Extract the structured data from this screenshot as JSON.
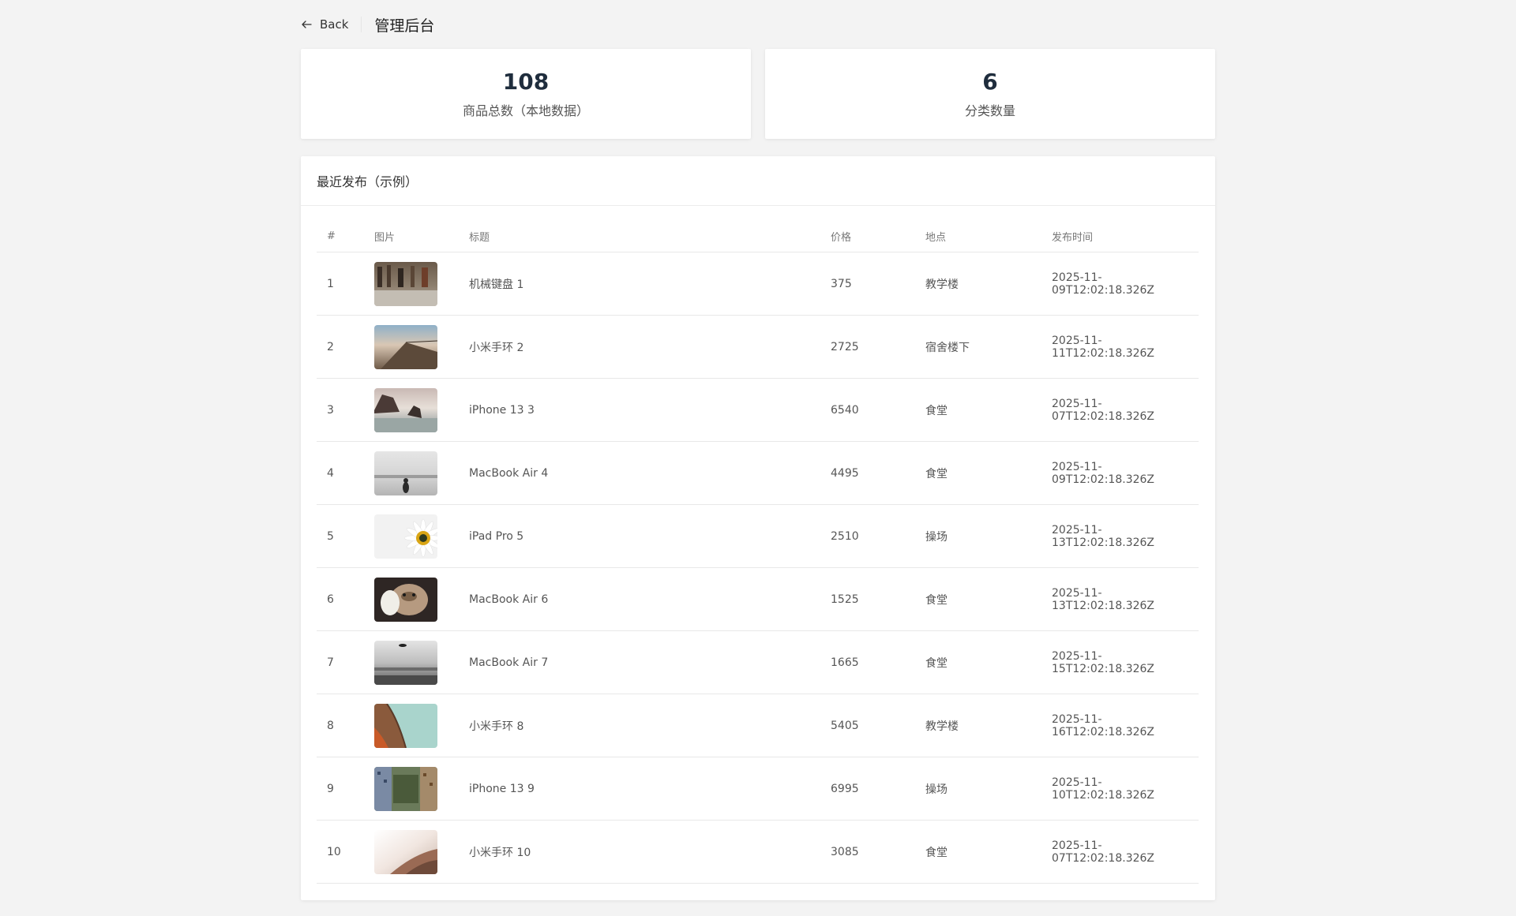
{
  "header": {
    "back_label": "Back",
    "title": "管理后台"
  },
  "stats": [
    {
      "value": "108",
      "label": "商品总数（本地数据）"
    },
    {
      "value": "6",
      "label": "分类数量"
    }
  ],
  "recent": {
    "title": "最近发布（示例）",
    "columns": [
      "#",
      "图片",
      "标题",
      "价格",
      "地点",
      "发布时间"
    ],
    "rows": [
      {
        "idx": "1",
        "title": "机械键盘 1",
        "price": "375",
        "place": "教学楼",
        "time": "2025-11-09T12:02:18.326Z"
      },
      {
        "idx": "2",
        "title": "小米手环 2",
        "price": "2725",
        "place": "宿舍楼下",
        "time": "2025-11-11T12:02:18.326Z"
      },
      {
        "idx": "3",
        "title": "iPhone 13 3",
        "price": "6540",
        "place": "食堂",
        "time": "2025-11-07T12:02:18.326Z"
      },
      {
        "idx": "4",
        "title": "MacBook Air 4",
        "price": "4495",
        "place": "食堂",
        "time": "2025-11-09T12:02:18.326Z"
      },
      {
        "idx": "5",
        "title": "iPad Pro 5",
        "price": "2510",
        "place": "操场",
        "time": "2025-11-13T12:02:18.326Z"
      },
      {
        "idx": "6",
        "title": "MacBook Air 6",
        "price": "1525",
        "place": "食堂",
        "time": "2025-11-13T12:02:18.326Z"
      },
      {
        "idx": "7",
        "title": "MacBook Air 7",
        "price": "1665",
        "place": "食堂",
        "time": "2025-11-15T12:02:18.326Z"
      },
      {
        "idx": "8",
        "title": "小米手环 8",
        "price": "5405",
        "place": "教学楼",
        "time": "2025-11-16T12:02:18.326Z"
      },
      {
        "idx": "9",
        "title": "iPhone 13 9",
        "price": "6995",
        "place": "操场",
        "time": "2025-11-10T12:02:18.326Z"
      },
      {
        "idx": "10",
        "title": "小米手环 10",
        "price": "3085",
        "place": "食堂",
        "time": "2025-11-07T12:02:18.326Z"
      }
    ]
  }
}
